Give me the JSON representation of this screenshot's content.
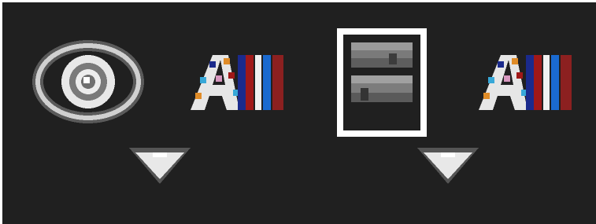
{
  "toolbar": {
    "buttons": [
      {
        "id": "visibility",
        "icon": "eye-icon",
        "selected": false
      },
      {
        "id": "channels-1",
        "icon": "rgb-channels-icon",
        "text": "A",
        "selected": false
      },
      {
        "id": "layers",
        "icon": "layers-icon",
        "selected": true
      },
      {
        "id": "channels-2",
        "icon": "rgb-channels-icon",
        "text": "A",
        "selected": false
      }
    ],
    "dropdowns": [
      {
        "icon": "chevron-down-icon"
      },
      {
        "icon": "chevron-down-icon"
      }
    ]
  },
  "colors": {
    "background": "#202020",
    "selection_border": "#ffffff",
    "channel_stripes": [
      "#1a2a8c",
      "#a01818",
      "#f0f0f0",
      "#1a6ad0",
      "#8c2020"
    ]
  }
}
